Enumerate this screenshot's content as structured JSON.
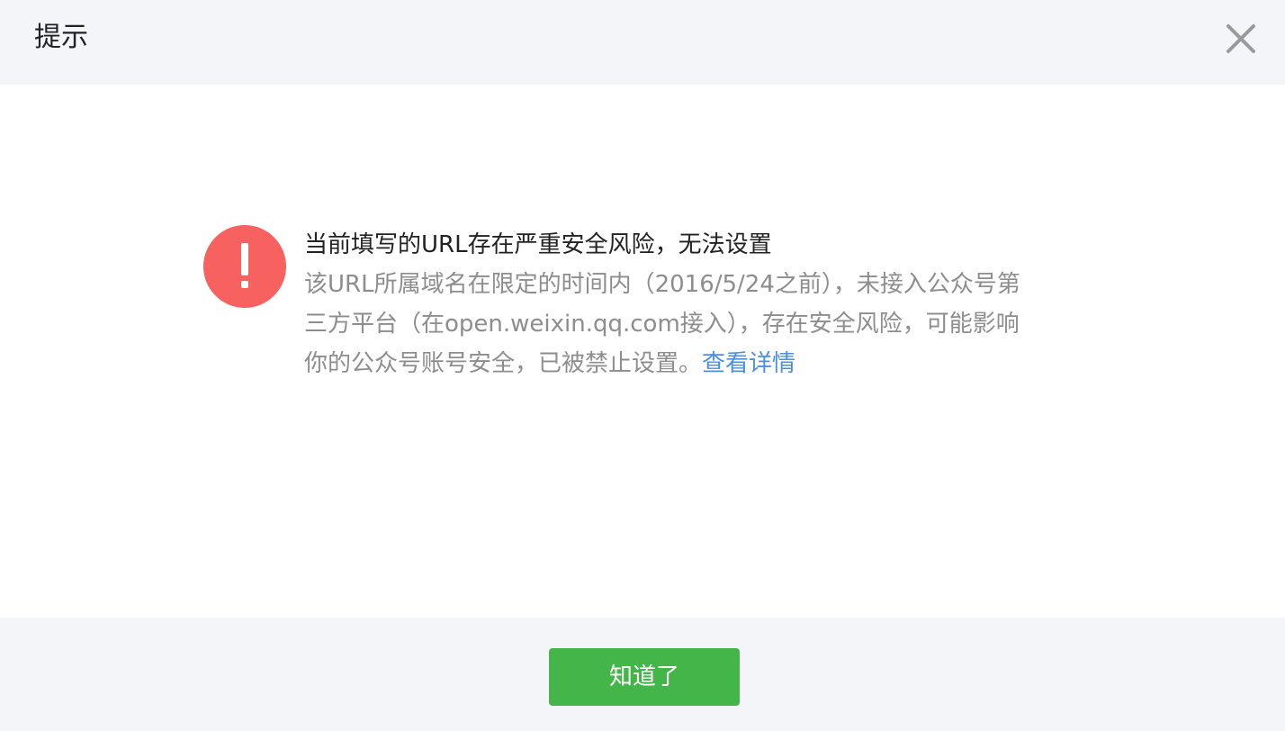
{
  "dialog": {
    "title": "提示",
    "close_icon": "close-icon"
  },
  "message": {
    "icon": "exclamation-icon",
    "icon_color": "#f76260",
    "title": "当前填写的URL存在严重安全风险，无法设置",
    "desc_lines": [
      "该URL所属域名在限定的时间内（2016/5/24之前），未接入公众号第",
      "三方平台（在open.weixin.qq.com接入），存在安全风险，可能影响",
      "你的公众号账号安全，已被禁止设置。"
    ],
    "detail_link": "查看详情",
    "link_color": "#4a90e2"
  },
  "footer": {
    "ok_label": "知道了",
    "ok_color": "#44b549"
  }
}
